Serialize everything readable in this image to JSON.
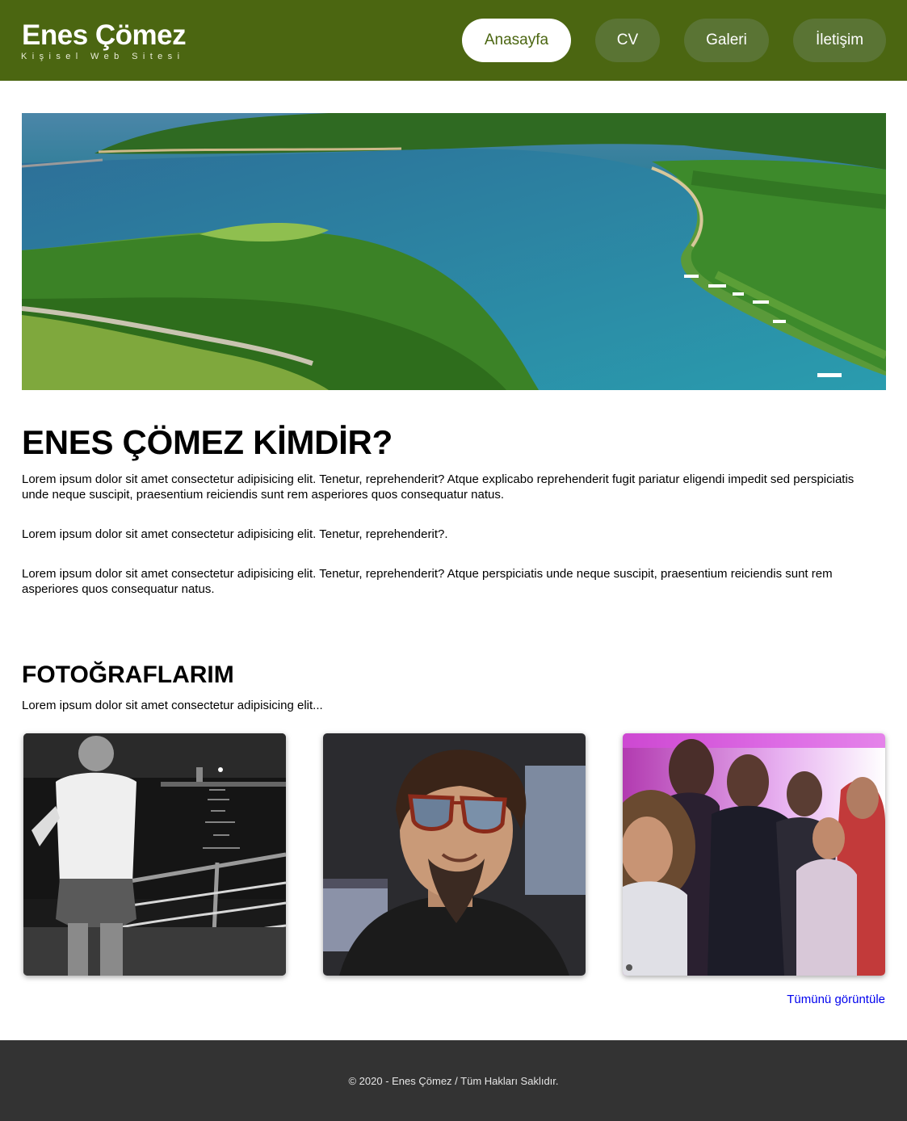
{
  "header": {
    "title": "Enes Çömez",
    "subtitle": "Kişisel Web Sitesi",
    "nav": [
      {
        "label": "Anasayfa",
        "active": true
      },
      {
        "label": "CV",
        "active": false
      },
      {
        "label": "Galeri",
        "active": false
      },
      {
        "label": "İletişim",
        "active": false
      }
    ]
  },
  "about": {
    "title": "ENES ÇÖMEZ KİMDİR?",
    "paragraphs": [
      "Lorem ipsum dolor sit amet consectetur adipisicing elit. Tenetur, reprehenderit? Atque explicabo reprehenderit fugit pariatur eligendi impedit sed perspiciatis unde neque suscipit, praesentium reiciendis sunt rem asperiores quos consequatur natus.",
      "Lorem ipsum dolor sit amet consectetur adipisicing elit. Tenetur, reprehenderit?.",
      "Lorem ipsum dolor sit amet consectetur adipisicing elit. Tenetur, reprehenderit? Atque perspiciatis unde neque suscipit, praesentium reiciendis sunt rem asperiores quos consequatur natus."
    ]
  },
  "photos": {
    "title": "FOTOĞRAFLARIM",
    "description": "Lorem ipsum dolor sit amet consectetur adipisicing elit...",
    "view_all": "Tümünü görüntüle"
  },
  "footer": {
    "copyright": "© 2020 - Enes Çömez / Tüm Hakları Saklıdır."
  },
  "colors": {
    "header_bg": "#4b6611",
    "nav_bg": "#5a7434",
    "footer_bg": "#333333",
    "link": "#0000ee"
  }
}
